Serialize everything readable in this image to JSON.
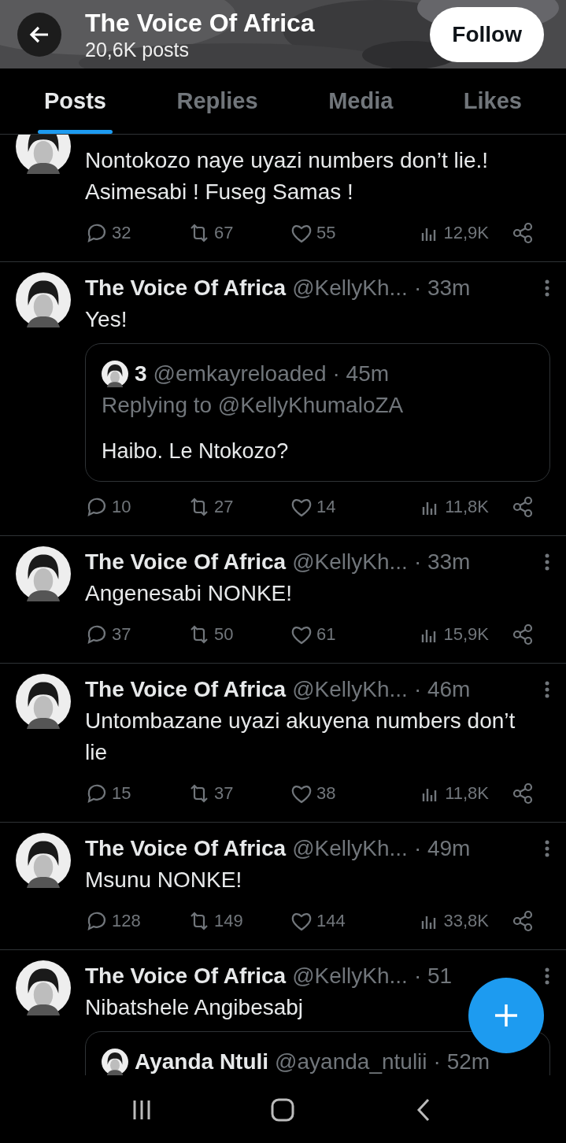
{
  "header": {
    "title": "The Voice Of Africa",
    "subtitle": "20,6K posts",
    "follow_button": "Follow"
  },
  "tabs": [
    {
      "label": "Posts",
      "selected": true
    },
    {
      "label": "Replies",
      "selected": false
    },
    {
      "label": "Media",
      "selected": false
    },
    {
      "label": "Likes",
      "selected": false
    }
  ],
  "posts": [
    {
      "text": "Nontokozo naye uyazi numbers don’t lie.! Asimesabi ! Fuseg Samas !",
      "stats": {
        "replies": "32",
        "reposts": "67",
        "likes": "55",
        "views": "12,9K"
      }
    },
    {
      "name": "The Voice Of Africa",
      "handle": "@KellyKh...",
      "time": "· 33m",
      "text": "Yes!",
      "quote": {
        "name": "3",
        "handle": "@emkayreloaded",
        "time": "· 45m",
        "replying": "Replying to @KellyKhumaloZA",
        "text": "Haibo. Le Ntokozo?"
      },
      "stats": {
        "replies": "10",
        "reposts": "27",
        "likes": "14",
        "views": "11,8K"
      }
    },
    {
      "name": "The Voice Of Africa",
      "handle": "@KellyKh...",
      "time": "· 33m",
      "text": "Angenesabi NONKE!",
      "stats": {
        "replies": "37",
        "reposts": "50",
        "likes": "61",
        "views": "15,9K"
      }
    },
    {
      "name": "The Voice Of Africa",
      "handle": "@KellyKh...",
      "time": "· 46m",
      "text": "Untombazane uyazi akuyena numbers don’t lie",
      "stats": {
        "replies": "15",
        "reposts": "37",
        "likes": "38",
        "views": "11,8K"
      }
    },
    {
      "name": "The Voice Of Africa",
      "handle": "@KellyKh...",
      "time": "· 49m",
      "text": "Msunu NONKE!",
      "stats": {
        "replies": "128",
        "reposts": "149",
        "likes": "144",
        "views": "33,8K"
      }
    },
    {
      "name": "The Voice Of Africa",
      "handle": "@KellyKh...",
      "time": "· 51",
      "text": "Nibatshele Angibesabj",
      "quote": {
        "name": "Ayanda Ntuli",
        "handle": "@ayanda_ntulii",
        "time": "· 52m"
      }
    }
  ]
}
